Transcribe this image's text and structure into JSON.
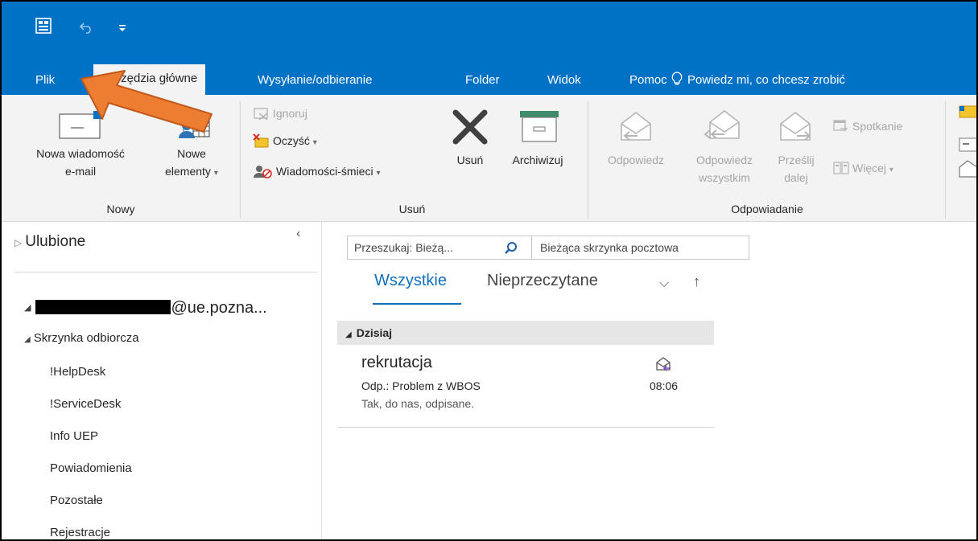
{
  "tabs": [
    {
      "label": "Plik"
    },
    {
      "label": "Narzędzia główne"
    },
    {
      "label": "Wysyłanie/odbieranie"
    },
    {
      "label": "Folder"
    },
    {
      "label": "Widok"
    },
    {
      "label": "Pomoc"
    }
  ],
  "tell_me": "Powiedz mi, co chcesz zrobić",
  "ribbon": {
    "new_email": [
      "Nowa wiadomość",
      "e-mail"
    ],
    "new_items": [
      "Nowe",
      "elementy"
    ],
    "group_new": "Nowy",
    "ignore": "Ignoruj",
    "clean": "Oczyść",
    "junk": "Wiadomości-śmieci",
    "delete": "Usuń",
    "archive": "Archiwizuj",
    "group_delete": "Usuń",
    "reply": "Odpowiedz",
    "reply_all": [
      "Odpowiedz",
      "wszystkim"
    ],
    "forward": [
      "Prześlij",
      "dalej"
    ],
    "meeting": "Spotkanie",
    "more": "Więcej",
    "group_respond": "Odpowiadanie"
  },
  "folders": {
    "favorites": "Ulubione",
    "account": "@ue.pozna...",
    "inbox": "Skrzynka odbiorcza",
    "items": [
      "!HelpDesk",
      "!ServiceDesk",
      "Info UEP",
      "Powiadomienia",
      "Pozostałe",
      "Rejestracje"
    ]
  },
  "messages": {
    "search_placeholder": "Przeszukaj: Bieżą...",
    "scope": "Bieżąca skrzynka pocztowa",
    "filter_all": "Wszystkie",
    "filter_unread": "Nieprzeczytane",
    "group": "Dzisiaj",
    "items": [
      {
        "sender": "rekrutacja",
        "subject": "Odp.: Problem z WBOS",
        "preview": "Tak, do nas, odpisane.",
        "time": "08:06"
      }
    ]
  },
  "colors": {
    "title_blue": "#0072c6",
    "accent": "#106ebe",
    "arrow": "#ed7d31"
  },
  "icons": [
    "outlook-icon",
    "undo-icon",
    "customize-toolbar-icon",
    "lightbulb-icon",
    "new-email-icon",
    "new-items-icon",
    "ignore-icon",
    "clean-icon",
    "junk-icon",
    "delete-icon",
    "archive-icon",
    "reply-icon",
    "reply-all-icon",
    "forward-icon",
    "meeting-icon",
    "more-icon",
    "search-icon",
    "collapse-icon",
    "sort-icon",
    "replied-icon"
  ]
}
